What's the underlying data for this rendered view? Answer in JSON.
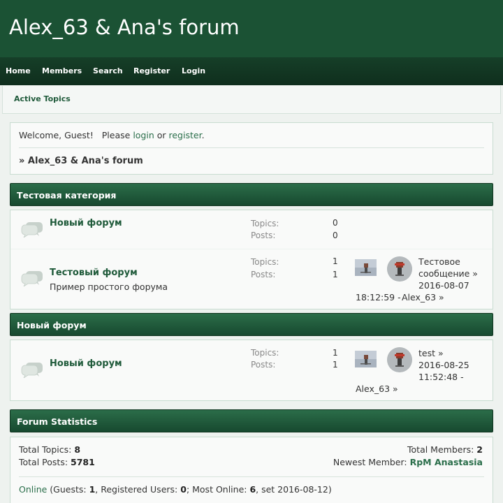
{
  "header": {
    "title": "Alex_63 & Ana's forum"
  },
  "nav": {
    "home": "Home",
    "members": "Members",
    "search": "Search",
    "register": "Register",
    "login": "Login"
  },
  "subnav": {
    "active_topics": "Active Topics"
  },
  "welcome": {
    "prefix": "Welcome, Guest!   Please ",
    "login": "login",
    "or": " or ",
    "register": "register",
    "suffix": ".",
    "breadcrumb": "» Alex_63 & Ana's forum"
  },
  "categories": [
    {
      "title": "Тестовая категория",
      "forums": [
        {
          "name": "Новый форум",
          "description": "",
          "topics_label": "Topics:",
          "topics": "0",
          "posts_label": "Posts:",
          "posts": "0"
        },
        {
          "name": "Тестовый форум",
          "description": "Пример простого форума",
          "topics_label": "Topics:",
          "topics": "1",
          "posts_label": "Posts:",
          "posts": "1",
          "last_post": {
            "title_line1": "Тестовое",
            "title_line2": "сообщение »",
            "date": "2016-08-07",
            "time": "18:12:59 - ",
            "author": "Alex_63 »"
          }
        }
      ]
    },
    {
      "title": "Новый форум",
      "forums": [
        {
          "name": "Новый форум",
          "description": "",
          "topics_label": "Topics:",
          "topics": "1",
          "posts_label": "Posts:",
          "posts": "1",
          "last_post": {
            "title": "test »",
            "date": "2016-08-25",
            "time": "11:52:48 -",
            "author": "Alex_63 »"
          }
        }
      ]
    }
  ],
  "statistics": {
    "title": "Forum Statistics",
    "total_topics_label": "Total Topics: ",
    "total_topics": "8",
    "total_posts_label": "Total Posts: ",
    "total_posts": "5781",
    "total_members_label": "Total Members: ",
    "total_members": "2",
    "newest_member_label": "Newest Member: ",
    "newest_member": "RpM Anastasia",
    "online_link": "Online",
    "guests_label": " (Guests: ",
    "guests": "1",
    "registered_label": ", Registered Users: ",
    "registered": "0",
    "most_online_label": "; Most Online: ",
    "most_online": "6",
    "set_label": ", set 2016-08-12)"
  },
  "colors": {
    "header": "#1b5234",
    "navbar": "#0f2e1d",
    "category_bar": "#225c3c",
    "link": "#2a6e4a"
  },
  "icons": {
    "forum": "speech-bubbles-icon",
    "thumbnail": "post-thumbnail",
    "avatar": "user-avatar"
  }
}
